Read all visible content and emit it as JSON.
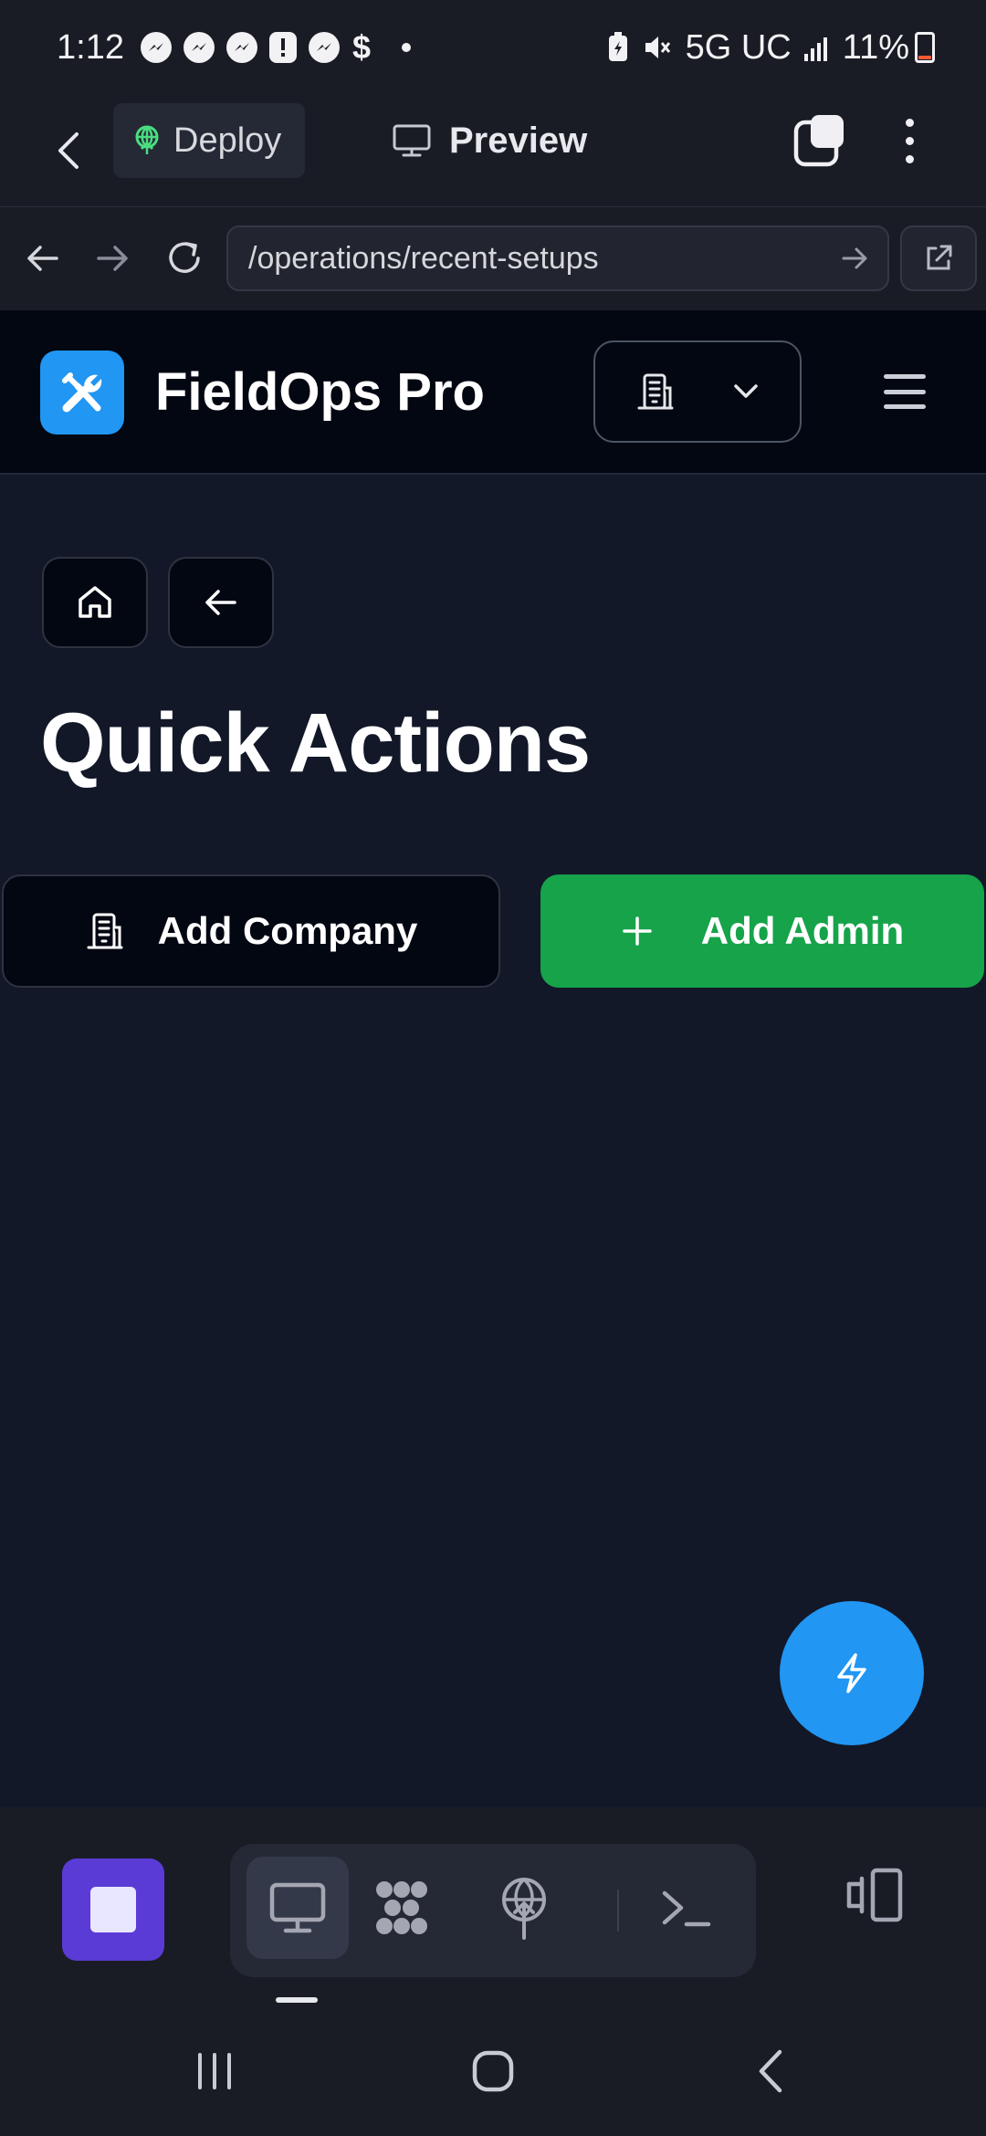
{
  "status_bar": {
    "time": "1:12",
    "dollar": "$",
    "network": "5G UC",
    "battery": "11%",
    "icons": [
      "messenger-icon",
      "messenger-icon",
      "messenger-icon",
      "alert-icon",
      "messenger-icon",
      "dollar-icon",
      "battery-saver-icon",
      "mute-icon",
      "signal-icon",
      "battery-icon"
    ]
  },
  "app_bar": {
    "deploy_label": "Deploy",
    "preview_label": "Preview"
  },
  "browser": {
    "url": "/operations/recent-setups"
  },
  "site": {
    "brand": "FieldOps Pro",
    "accent": "#2196f3",
    "header_bg": "#030712"
  },
  "page": {
    "title": "Quick Actions",
    "actions": [
      {
        "label": "Add Company",
        "icon": "building-icon"
      },
      {
        "label": "Add Admin",
        "icon": "plus-icon",
        "color": "#16a34a"
      }
    ]
  },
  "dock": {
    "tools": [
      "preview-icon",
      "shapes-icon",
      "deploy-icon",
      "terminal-icon"
    ],
    "stop_color": "#5b3bd6"
  }
}
